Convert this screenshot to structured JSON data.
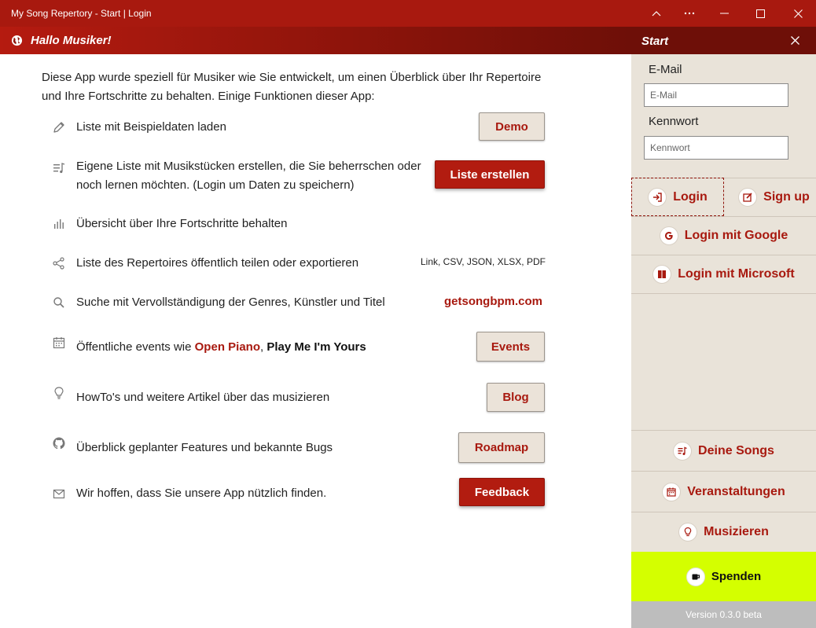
{
  "window": {
    "title": "My Song Repertory - Start | Login"
  },
  "header": {
    "title": "Hallo Musiker!"
  },
  "intro": "Diese App wurde speziell für Musiker wie Sie entwickelt, um einen Überblick über Ihr Re­pertoire und Ihre Fortschritte zu behalten. Einige Funktionen dieser App:",
  "features": {
    "demo": {
      "text": "Liste mit Beispieldaten laden",
      "button": "Demo"
    },
    "create": {
      "text": "Eigene Liste mit Musikstücken erstellen, die Sie beherrschen oder noch lernen möchten. (Login um Daten zu speichern)",
      "button": "Liste erstellen"
    },
    "progress": {
      "text": "Übersicht über Ihre Fortschritte behalten"
    },
    "share": {
      "text": "Liste des Repertoires öffentlich teilen oder exportieren",
      "formats": "Link, CSV, JSON, XLSX, PDF"
    },
    "search": {
      "text": "Suche mit Vervollständigung der Genres, Künstler und Titel",
      "link": "getsongbpm.com"
    },
    "events": {
      "text_prefix": "Öffentliche events wie ",
      "link1": "Open Piano",
      "sep": ", ",
      "link2": "Play Me I'm Yours",
      "button": "Events"
    },
    "blog": {
      "text": "HowTo's und weitere Artikel über das musizieren",
      "button": "Blog"
    },
    "roadmap": {
      "text": "Überblick geplanter Features und bekannte Bugs",
      "button": "Roadmap"
    },
    "feedback": {
      "text": "Wir hoffen, dass Sie unsere App nützlich finden.",
      "button": "Feedback"
    }
  },
  "panel": {
    "title": "Start",
    "email_label": "E-Mail",
    "email_placeholder": "E-Mail",
    "password_label": "Kennwort",
    "password_placeholder": "Kennwort",
    "login": "Login",
    "signup": "Sign up",
    "login_google": "Login mit Google",
    "login_microsoft": "Login mit Microsoft",
    "nav_songs": "Deine Songs",
    "nav_events": "Veranstaltungen",
    "nav_music": "Musizieren",
    "donate": "Spenden",
    "version": "Version 0.3.0 beta"
  },
  "colors": {
    "brand": "#a8190f",
    "brand_dark": "#6e0f08",
    "panel_bg": "#e9e3d9",
    "donate_bg": "#d4ff00"
  }
}
